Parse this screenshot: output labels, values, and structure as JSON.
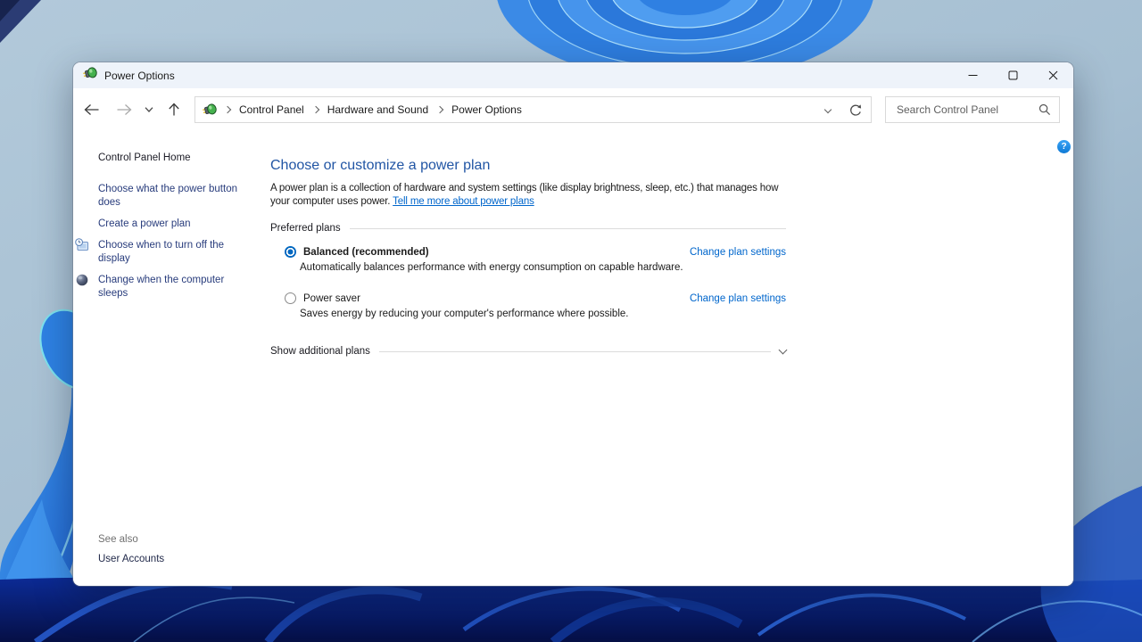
{
  "window": {
    "title": "Power Options"
  },
  "navbar": {
    "breadcrumb": [
      "Control Panel",
      "Hardware and Sound",
      "Power Options"
    ],
    "search_placeholder": "Search Control Panel"
  },
  "sidebar": {
    "home_label": "Control Panel Home",
    "tasks": [
      {
        "label": "Choose what the power button does",
        "icon": "none"
      },
      {
        "label": "Create a power plan",
        "icon": "none"
      },
      {
        "label": "Choose when to turn off the display",
        "icon": "display-clock-icon"
      },
      {
        "label": "Change when the computer sleeps",
        "icon": "sleep-moon-icon"
      }
    ],
    "see_also_label": "See also",
    "see_also_links": [
      "User Accounts"
    ]
  },
  "main": {
    "heading": "Choose or customize a power plan",
    "intro_text": "A power plan is a collection of hardware and system settings (like display brightness, sleep, etc.) that manages how your computer uses power.",
    "intro_link": "Tell me more about power plans",
    "preferred_plans_label": "Preferred plans",
    "plans": [
      {
        "name": "Balanced (recommended)",
        "selected": true,
        "description": "Automatically balances performance with energy consumption on capable hardware.",
        "action": "Change plan settings"
      },
      {
        "name": "Power saver",
        "selected": false,
        "description": "Saves energy by reducing your computer's performance where possible.",
        "action": "Change plan settings"
      }
    ],
    "show_additional_label": "Show additional plans"
  },
  "help": {
    "label": "?"
  },
  "colors": {
    "titlebar_bg": "#eef3fa",
    "heading_blue": "#2155a4",
    "link_blue": "#0066cc",
    "sidebar_link_blue": "#283c7c",
    "selected_radio_blue": "#0067c0",
    "box_border": "#d9d9d9",
    "desktop_light_blue": "#a9c2d5",
    "desktop_dark_blue": "#0a1f6e"
  }
}
